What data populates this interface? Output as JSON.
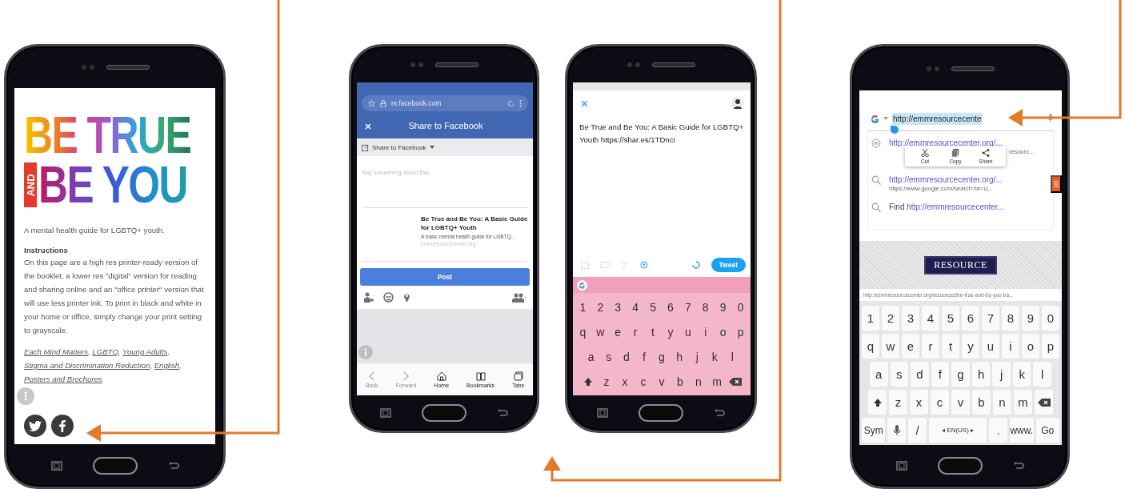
{
  "phones": [
    {
      "kind": "website",
      "logo_top": "BE TRUE",
      "logo_and": "AND",
      "logo_bottom": "BE YOU",
      "tagline": "A mental health guide for LGBTQ+ youth.",
      "heading": "Instructions",
      "body": "On this page are a high res printer-ready version of the booklet, a lower res \"digital\" version for reading and sharing online and an \"office printer\" version that will use less printer ink. To print in black and white in your home or office, simply change your print setting to grayscale.",
      "tags": [
        {
          "label": "Each Mind Matters",
          "sep": ","
        },
        {
          "label": "LGBTQ",
          "sep": ","
        },
        {
          "label": "Young Adults",
          "sep": ","
        },
        {
          "label": "Stigma and Discrimination Reduction",
          "sep": ","
        },
        {
          "label": "English",
          "sep": ","
        },
        {
          "label": "Posters and Brochures"
        }
      ]
    },
    {
      "kind": "facebook",
      "url": "m.facebook.com",
      "title": "Share to Facebook",
      "audience": "Share to Facebook",
      "placeholder": "Say something about this...",
      "link_title": "Be True and Be You: A Basic Guide for LGBTQ+ Youth",
      "link_desc": "A basic mental health guide for LGBTQ...",
      "link_domain": "emmresourcecenter.org",
      "post": "Post",
      "nav": [
        {
          "label": "Back",
          "disabled": true
        },
        {
          "label": "Forward",
          "disabled": true
        },
        {
          "label": "Home",
          "disabled": false
        },
        {
          "label": "Bookmarks",
          "disabled": false
        },
        {
          "label": "Tabs",
          "disabled": false
        }
      ]
    },
    {
      "kind": "twitter",
      "text": "Be True and Be You: A Basic Guide for LGBTQ+ Youth https://shar.es/1TDnci",
      "button": "Tweet",
      "keyboard": [
        [
          "1",
          "2",
          "3",
          "4",
          "5",
          "6",
          "7",
          "8",
          "9",
          "0"
        ],
        [
          "q",
          "w",
          "e",
          "r",
          "t",
          "y",
          "u",
          "i",
          "o",
          "p"
        ],
        [
          "a",
          "s",
          "d",
          "f",
          "g",
          "h",
          "j",
          "k",
          "l"
        ],
        [
          {
            "kind": "shift"
          },
          "z",
          "x",
          "c",
          "v",
          "b",
          "n",
          "m",
          {
            "kind": "backspace"
          }
        ]
      ]
    },
    {
      "kind": "browser",
      "url": "http://emmresourcecente",
      "menu": [
        "Cut",
        "Copy",
        "Share"
      ],
      "suggestions": [
        {
          "kind": "site",
          "title": "http://emmresourcecenter.org/...",
          "subtitle": "resourc..."
        },
        {
          "kind": "search",
          "title": "http://emmresourcecenter.org/...",
          "subtitle": "https://www.google.com/search?ie=U..."
        },
        {
          "kind": "search",
          "find": "Find",
          "title": "http://emmresourcecenter..."
        }
      ],
      "banner": "RESOURCE",
      "page_url": "http://emmresourcecenter.org/resources/be-true-and-be-you-ba...",
      "keyboard": [
        [
          "1",
          "2",
          "3",
          "4",
          "5",
          "6",
          "7",
          "8",
          "9",
          "0"
        ],
        [
          "q",
          "w",
          "e",
          "r",
          "t",
          "y",
          "u",
          "i",
          "o",
          "p"
        ],
        [
          "a",
          "s",
          "d",
          "f",
          "g",
          "h",
          "j",
          "k",
          "l"
        ],
        [
          {
            "kind": "shift"
          },
          "z",
          "x",
          "c",
          "v",
          "b",
          "n",
          "m",
          {
            "kind": "backspace"
          }
        ],
        [
          "Sym",
          {
            "kind": "mic"
          },
          "/",
          {
            "kind": "space",
            "label": "◂ EN(US) ▸"
          },
          ".",
          "www.",
          "Go"
        ]
      ]
    }
  ]
}
